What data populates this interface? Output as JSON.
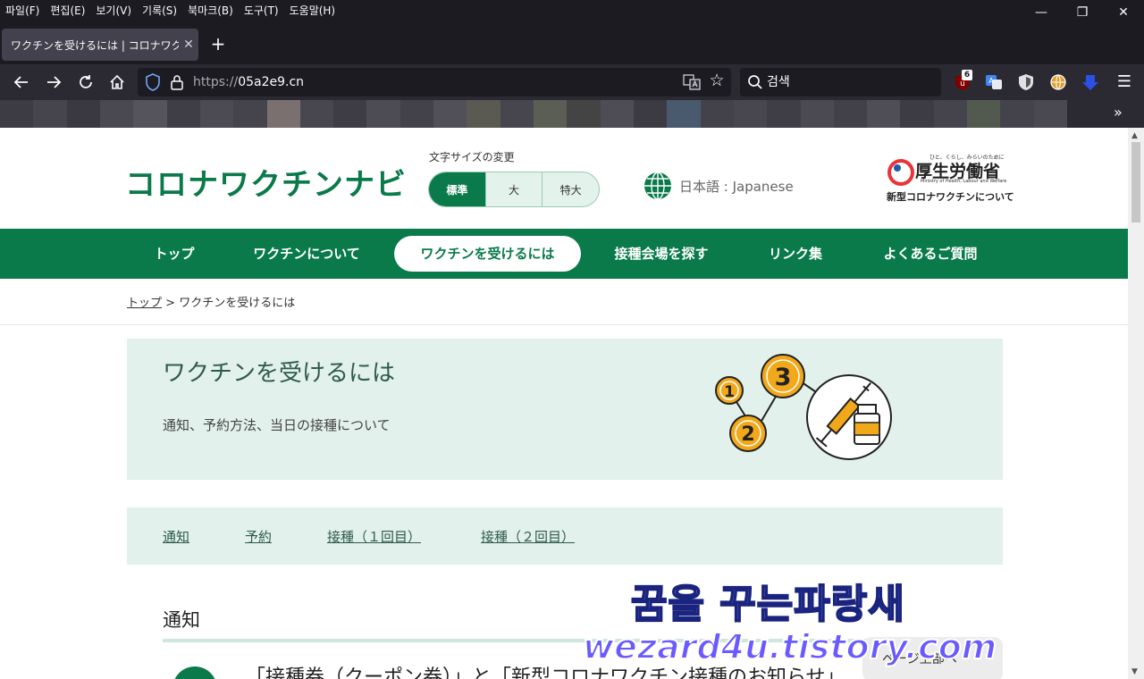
{
  "menubar": {
    "items": [
      "파일(F)",
      "편집(E)",
      "보기(V)",
      "기록(S)",
      "북마크(B)",
      "도구(T)",
      "도움말(H)"
    ]
  },
  "window_controls": {
    "minimize": "—",
    "restore": "❐",
    "close": "✕"
  },
  "tab": {
    "title": "ワクチンを受けるには | コロナワクチンナビ",
    "close": "✕",
    "new_tab": "+"
  },
  "toolbar": {
    "url_scheme": "https://",
    "url_host": "05a2e9.cn",
    "search_placeholder": "검색",
    "extension_badge": "6"
  },
  "site": {
    "logo": "コロナワクチンナビ",
    "font_size_label": "文字サイズの変更",
    "font_sizes": [
      "標準",
      "大",
      "特大"
    ],
    "language": "日本語 : Japanese",
    "ministry_tagline": "ひと、くらし、みらいのために",
    "ministry_name": "厚生労働省",
    "ministry_en": "Ministry of Health, Labour and Welfare",
    "ministry_sub": "新型コロナワクチンについて"
  },
  "nav": {
    "items": [
      "トップ",
      "ワクチンについて",
      "ワクチンを受けるには",
      "接種会場を探す",
      "リンク集",
      "よくあるご質問"
    ],
    "active": "ワクチンを受けるには"
  },
  "breadcrumb": {
    "home": "トップ",
    "separator": " > ",
    "current": "ワクチンを受けるには"
  },
  "hero": {
    "title": "ワクチンを受けるには",
    "description": "通知、予約方法、当日の接種について",
    "steps": [
      "1",
      "2",
      "3"
    ]
  },
  "anchors": [
    "通知",
    "予約",
    "接種（１回目）",
    "接種（２回目）"
  ],
  "section": {
    "title": "通知",
    "notice": "「接種券（クーポン券）」と「新型コロナワクチン接種のお知らせ」",
    "page_top": "ページ上部へ"
  },
  "watermark": {
    "line1": "꿈을 꾸는파랑새",
    "line2": "wezard4u.tistory.com"
  },
  "colors": {
    "brand_green": "#0a7a4a",
    "light_green": "#e2f1ec",
    "chrome_dark": "#1c1b22",
    "chrome_mid": "#2b2a33"
  }
}
